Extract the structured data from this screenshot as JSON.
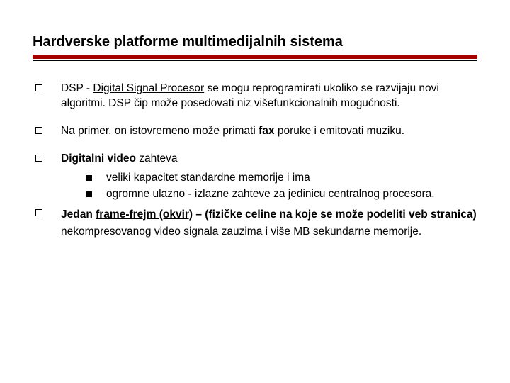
{
  "title": "Hardverske platforme multimedijalnih sistema",
  "items": {
    "p1_a": "DSP - ",
    "p1_b": "Digital Signal Procesor",
    "p1_c": " se mogu reprogramirati ukoliko se razvijaju novi algoritmi.  DSP čip može posedovati niz višefunkcionalnih mogućnosti.",
    "p2_a": "Na primer, on istovremeno može primati ",
    "p2_b": "fax",
    "p2_c": " poruke i emitovati muziku.",
    "p3_a": "Digitalni video",
    "p3_b": " zahteva",
    "p3_sub1": "veliki kapacitet standardne memorije i ima",
    "p3_sub2": "ogromne ulazno - izlazne zahteve za jedinicu centralnog procesora.",
    "p4_a": "Jedan ",
    "p4_b": "frame-frejm (okvir)",
    "p4_c": " – (fizičke celine na koje se može podeliti veb stranica)",
    "p4_d": "  nekompresovanog video signala zauzima i više MB sekundarne memorije."
  }
}
